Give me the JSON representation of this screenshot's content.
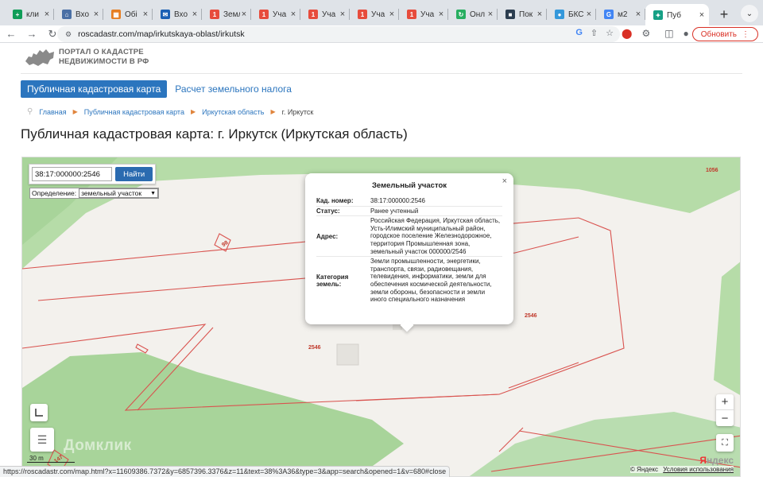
{
  "browser": {
    "tabs": [
      {
        "label": "кли",
        "icon": "sheets-icon",
        "color": "#0f9d58"
      },
      {
        "label": "Вхо",
        "icon": "home-icon",
        "color": "#4a6fa5"
      },
      {
        "label": "Обі",
        "icon": "grid-icon",
        "color": "#e67e22"
      },
      {
        "label": "Вхо",
        "icon": "mail-icon",
        "color": "#1a5fb4"
      },
      {
        "label": "Земл",
        "icon": "notification-icon",
        "color": "#e74c3c"
      },
      {
        "label": "Уча",
        "icon": "notification-icon",
        "color": "#e74c3c"
      },
      {
        "label": "Уча",
        "icon": "notification-icon",
        "color": "#e74c3c"
      },
      {
        "label": "Уча",
        "icon": "notification-icon",
        "color": "#e74c3c"
      },
      {
        "label": "Уча",
        "icon": "notification-icon",
        "color": "#e74c3c"
      },
      {
        "label": "Онл",
        "icon": "refresh-icon",
        "color": "#27ae60"
      },
      {
        "label": "Пок",
        "icon": "flag-icon",
        "color": "#2c3e50"
      },
      {
        "label": "БКС",
        "icon": "globe-icon",
        "color": "#3498db"
      },
      {
        "label": "м2",
        "icon": "google-icon",
        "color": "#4285f4"
      },
      {
        "label": "Пуб",
        "icon": "map-icon",
        "color": "#16a085"
      }
    ],
    "new_tab": "+",
    "tab_menu": "⌄",
    "url": "roscadastr.com/map/irkutskaya-oblast/irkutsk",
    "update_label": "Обновить",
    "status_url": "https://roscadastr.com/map.html?x=11609386.7372&y=6857396.3376&z=11&text=38%3A36&type=3&app=search&opened=1&v=680#close"
  },
  "site": {
    "logo_line1": "ПОРТАЛ О КАДАСТРЕ",
    "logo_line2": "НЕДВИЖИМОСТИ В РФ",
    "nav_active": "Публичная кадастровая карта",
    "nav_other": "Расчет земельного налога",
    "breadcrumbs": [
      "Главная",
      "Публичная кадастровая карта",
      "Иркутская область",
      "г. Иркутск"
    ],
    "page_title": "Публичная кадастровая карта: г. Иркутск (Иркутская область)"
  },
  "map": {
    "search_value": "38:17:000000:2546",
    "search_button": "Найти",
    "definition_label": "Определение:",
    "definition_value": "земельный участок",
    "labels": {
      "l1056": "1056",
      "l2546a": "2546",
      "l2546b": "2546",
      "l98": "98",
      "l147": "147"
    },
    "scale": "30 m",
    "watermark": "Домклик",
    "yandex_logo_y": "Я",
    "yandex_logo_rest": "ндекс",
    "copyright": "© Яндекс",
    "terms": "Условия использования",
    "zoom_in": "+",
    "zoom_out": "−"
  },
  "popup": {
    "title": "Земельный участок",
    "close": "×",
    "rows": [
      {
        "key": "Кад. номер:",
        "value": "38:17:000000:2546"
      },
      {
        "key": "Статус:",
        "value": "Ранее учтенный"
      },
      {
        "key": "Адрес:",
        "value": "Российская Федерация, Иркутская область, Усть-Илимский муниципальный район, городское поселение Железнодорожное, территория Промышленная зона, земельный участок 000000/2546"
      },
      {
        "key": "Категория земель:",
        "value": "Земли промышленности, энергетики, транспорта, связи, радиовещания, телевидения, информатики, земли для обеспечения космической деятельности, земли обороны, безопасности и земли иного специального назначения"
      }
    ]
  },
  "colors": {
    "accent": "#2b75be",
    "parcel_line": "#d9534f",
    "map_green": "#a8d89a"
  }
}
